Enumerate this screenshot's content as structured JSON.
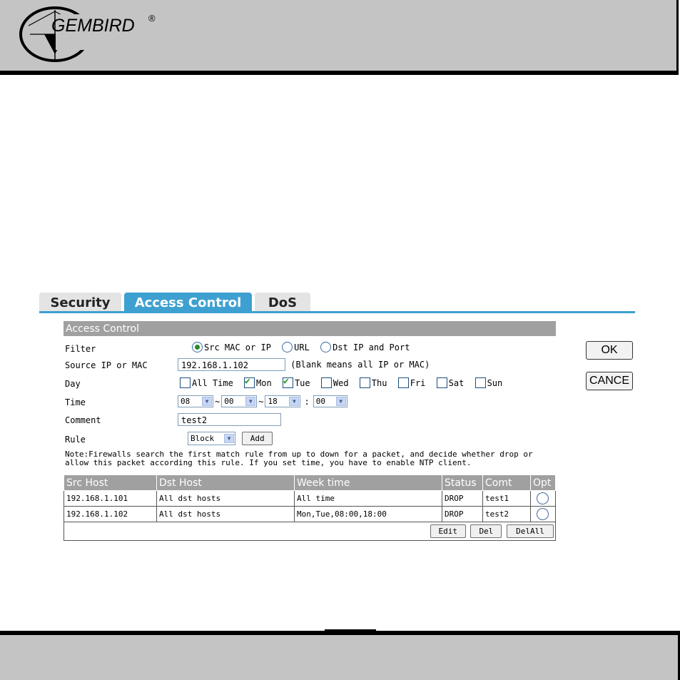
{
  "brand": {
    "name": "GEMBIRD",
    "registered": "®"
  },
  "tabs": [
    {
      "label": "Security",
      "active": false
    },
    {
      "label": "Access Control",
      "active": true
    },
    {
      "label": "DoS",
      "active": false
    }
  ],
  "panel": {
    "title": "Access Control",
    "filter": {
      "label": "Filter",
      "options": [
        {
          "label": "Src MAC or IP",
          "selected": true
        },
        {
          "label": "URL",
          "selected": false
        },
        {
          "label": "Dst IP and Port",
          "selected": false
        }
      ]
    },
    "source": {
      "label": "Source IP or MAC",
      "value": "192.168.1.102",
      "hint": "(Blank means all IP or MAC)"
    },
    "day": {
      "label": "Day",
      "options": [
        {
          "label": "All Time",
          "checked": false
        },
        {
          "label": "Mon",
          "checked": true
        },
        {
          "label": "Tue",
          "checked": true
        },
        {
          "label": "Wed",
          "checked": false
        },
        {
          "label": "Thu",
          "checked": false
        },
        {
          "label": "Fri",
          "checked": false
        },
        {
          "label": "Sat",
          "checked": false
        },
        {
          "label": "Sun",
          "checked": false
        }
      ]
    },
    "time": {
      "label": "Time",
      "start_hour": "08",
      "start_min": "00",
      "end_hour": "18",
      "end_min": "00",
      "range_sep": "~",
      "colon": ":"
    },
    "comment": {
      "label": "Comment",
      "value": "test2"
    },
    "rule": {
      "label": "Rule",
      "value": "Block",
      "add_label": "Add"
    },
    "note": "Note:Firewalls search the first match rule from up to down for a packet, and decide whether drop or allow this packet according this rule. If you set time, you have to enable NTP client."
  },
  "table": {
    "headers": [
      "Src Host",
      "Dst Host",
      "Week time",
      "Status",
      "Comt",
      "Opt"
    ],
    "rows": [
      {
        "src": "192.168.1.101",
        "dst": "All dst hosts",
        "week": "All time",
        "status": "DROP",
        "comt": "test1"
      },
      {
        "src": "192.168.1.102",
        "dst": "All dst hosts",
        "week": "Mon,Tue,08:00,18:00",
        "status": "DROP",
        "comt": "test2"
      }
    ],
    "actions": {
      "edit": "Edit",
      "del": "Del",
      "delall": "DelAll"
    }
  },
  "side": {
    "ok": "OK",
    "cancel": "CANCE"
  }
}
